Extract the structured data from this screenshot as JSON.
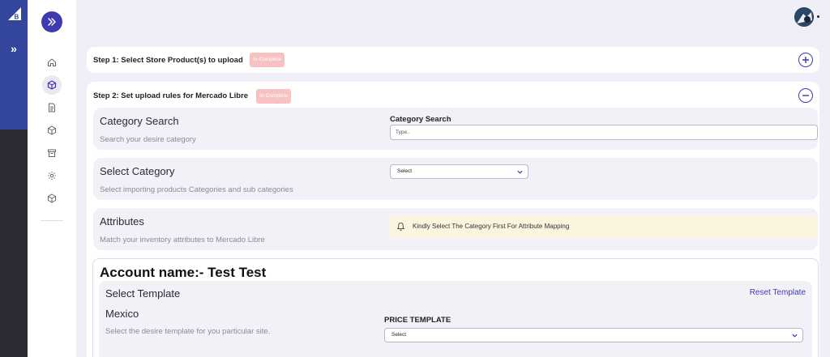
{
  "icons": {
    "platform_logo": "bigcommerce-logo-icon",
    "platform_expand": "double-chevron-right-icon",
    "sidebar_toggle": "double-chevron-right-icon",
    "nav": [
      "home-icon",
      "cube-icon",
      "document-icon",
      "box-icon",
      "archive-icon",
      "gear-icon",
      "cube-outline-icon"
    ],
    "add": "plus-circle-icon",
    "collapse": "minus-circle-icon",
    "alert": "bell-icon",
    "select_chevron": "chevron-down-icon"
  },
  "colors": {
    "accent": "#3f3ab0",
    "platform_blue": "#34469b",
    "badge": "#f7c2c1",
    "alert_bg": "#fbf5e0"
  },
  "platform": {
    "expand_glyph": "»"
  },
  "steps": [
    {
      "title": "Step 1: Select Store Product(s) to upload",
      "status": "In-Complete",
      "expanded": false
    },
    {
      "title": "Step 2: Set upload rules for Mercado Libre",
      "status": "In-Complete",
      "expanded": true
    }
  ],
  "category_search": {
    "heading": "Category Search",
    "description": "Search your desire category",
    "field_label": "Category Search",
    "placeholder": "Type..",
    "value": ""
  },
  "select_category": {
    "heading": "Select Category",
    "description": "Select importing products Categories and sub categories",
    "selected": "Select"
  },
  "attributes": {
    "heading": "Attributes",
    "description": "Match your inventory attributes to Mercado Libre",
    "alert": "Kindly Select The Category First For Attribute Mapping"
  },
  "account": {
    "title": "Account name:- Test Test",
    "template_heading": "Select Template",
    "reset_label": "Reset Template",
    "country": "Mexico",
    "description": "Select the desire template for you particular site.",
    "price_template_label": "PRICE TEMPLATE",
    "price_template_selected": "Select"
  }
}
